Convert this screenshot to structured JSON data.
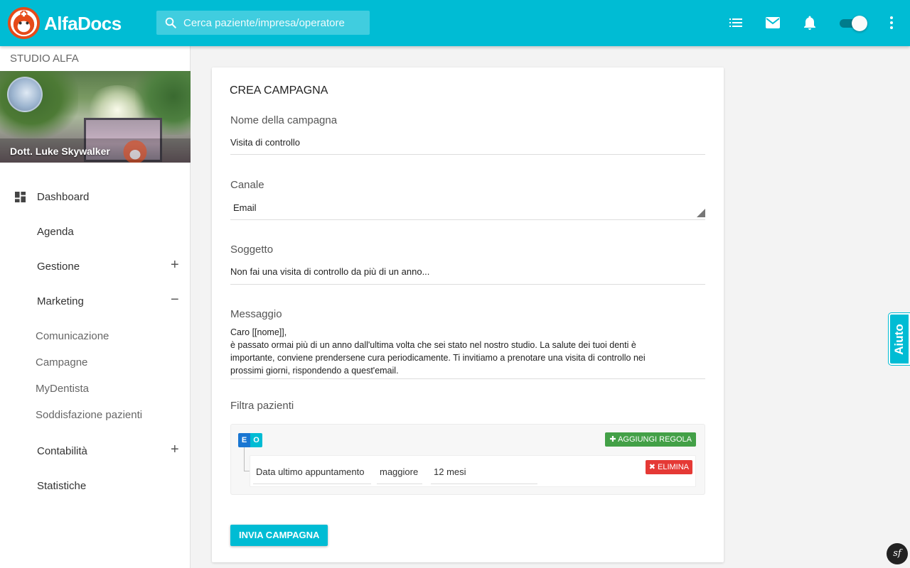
{
  "app": {
    "brand": "AlfaDocs"
  },
  "search": {
    "placeholder": "Cerca paziente/impresa/operatore"
  },
  "topbar": {
    "icons": [
      "list-icon",
      "mail-icon",
      "bell-icon",
      "toggle",
      "more-vert-icon"
    ],
    "accent": "#00bcd4"
  },
  "sidebar": {
    "studio": "STUDIO ALFA",
    "user_name": "Dott. Luke Skywalker",
    "items": [
      {
        "label": "Dashboard"
      },
      {
        "label": "Agenda"
      },
      {
        "label": "Gestione",
        "sign": "+"
      },
      {
        "label": "Marketing",
        "sign": "−"
      },
      {
        "label": "Comunicazione"
      },
      {
        "label": "Campagne"
      },
      {
        "label": "MyDentista"
      },
      {
        "label": "Soddisfazione pazienti"
      },
      {
        "label": "Contabilità",
        "sign": "+"
      },
      {
        "label": "Statistiche"
      }
    ]
  },
  "form": {
    "title": "CREA CAMPAGNA",
    "name_label": "Nome della campagna",
    "name_value": "Visita di controllo",
    "channel_label": "Canale",
    "channel_value": "Email",
    "subject_label": "Soggetto",
    "subject_value": "Non fai una visita di controllo da più di un anno...",
    "message_label": "Messaggio",
    "message_lines": [
      "Caro [[nome]],",
      "è passato ormai più di un anno dall'ultima volta che sei stato nel nostro studio. La salute dei tuoi denti è",
      "importante, conviene prendersene cura periodicamente. Ti invitiamo a prenotare una visita di controllo nei",
      "prossimi giorni, rispondendo a quest'email."
    ],
    "filter_label": "Filtra pazienti",
    "group_and": "E",
    "group_or": "O",
    "add_rule": "AGGIUNGI REGOLA",
    "rule": {
      "field": "Data ultimo appuntamento",
      "operator": "maggiore",
      "value": "12 mesi"
    },
    "delete_label": "ELIMINA",
    "submit_label": "INVIA CAMPAGNA"
  },
  "help": {
    "label": "Aiuto"
  },
  "debug": {
    "label": "sf"
  }
}
